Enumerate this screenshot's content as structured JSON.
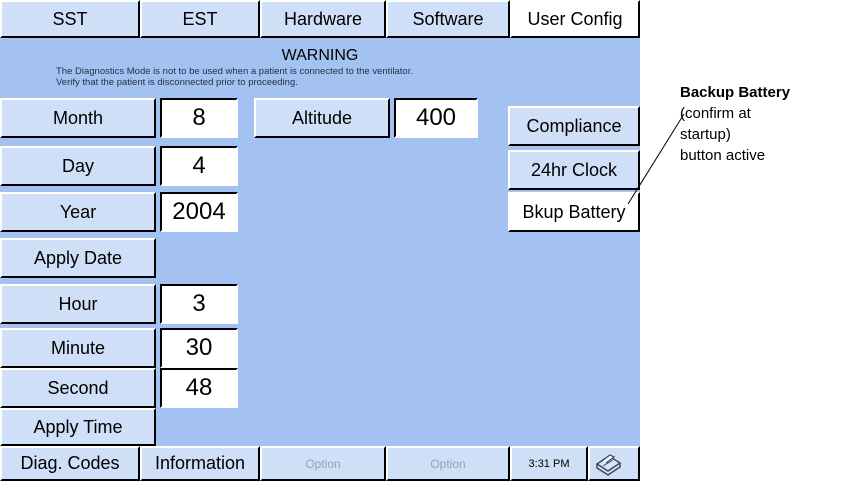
{
  "tabs": [
    {
      "label": "SST"
    },
    {
      "label": "EST"
    },
    {
      "label": "Hardware"
    },
    {
      "label": "Software"
    },
    {
      "label": "User Config"
    }
  ],
  "warning": {
    "title": "WARNING",
    "line1": "The Diagnostics Mode is not to be used when a patient is connected to the ventilator.",
    "line2": "Verify that the patient is disconnected prior to proceeding."
  },
  "date": {
    "month_label": "Month",
    "month_value": "8",
    "day_label": "Day",
    "day_value": "4",
    "year_label": "Year",
    "year_value": "2004",
    "apply_label": "Apply Date"
  },
  "altitude": {
    "label": "Altitude",
    "value": "400"
  },
  "time": {
    "hour_label": "Hour",
    "hour_value": "3",
    "minute_label": "Minute",
    "minute_value": "30",
    "second_label": "Second",
    "second_value": "48",
    "apply_label": "Apply Time"
  },
  "side_buttons": {
    "compliance": "Compliance",
    "clock24": "24hr Clock",
    "bkup_battery": "Bkup Battery"
  },
  "bottom_bar": {
    "diag_codes": "Diag. Codes",
    "information": "Information",
    "option1": "Option",
    "option2": "Option",
    "clock": "3:31 PM",
    "printer_icon": "printer-icon"
  },
  "annotation": {
    "title": "Backup Battery",
    "line1": "(confirm at",
    "line2": "startup)",
    "line3": "button active"
  },
  "colors": {
    "screen_bg": "#a3c1f1",
    "button_bg": "#cedff7",
    "selected_tab_bg": "#ffffff",
    "disabled_text": "#93a4b8"
  }
}
